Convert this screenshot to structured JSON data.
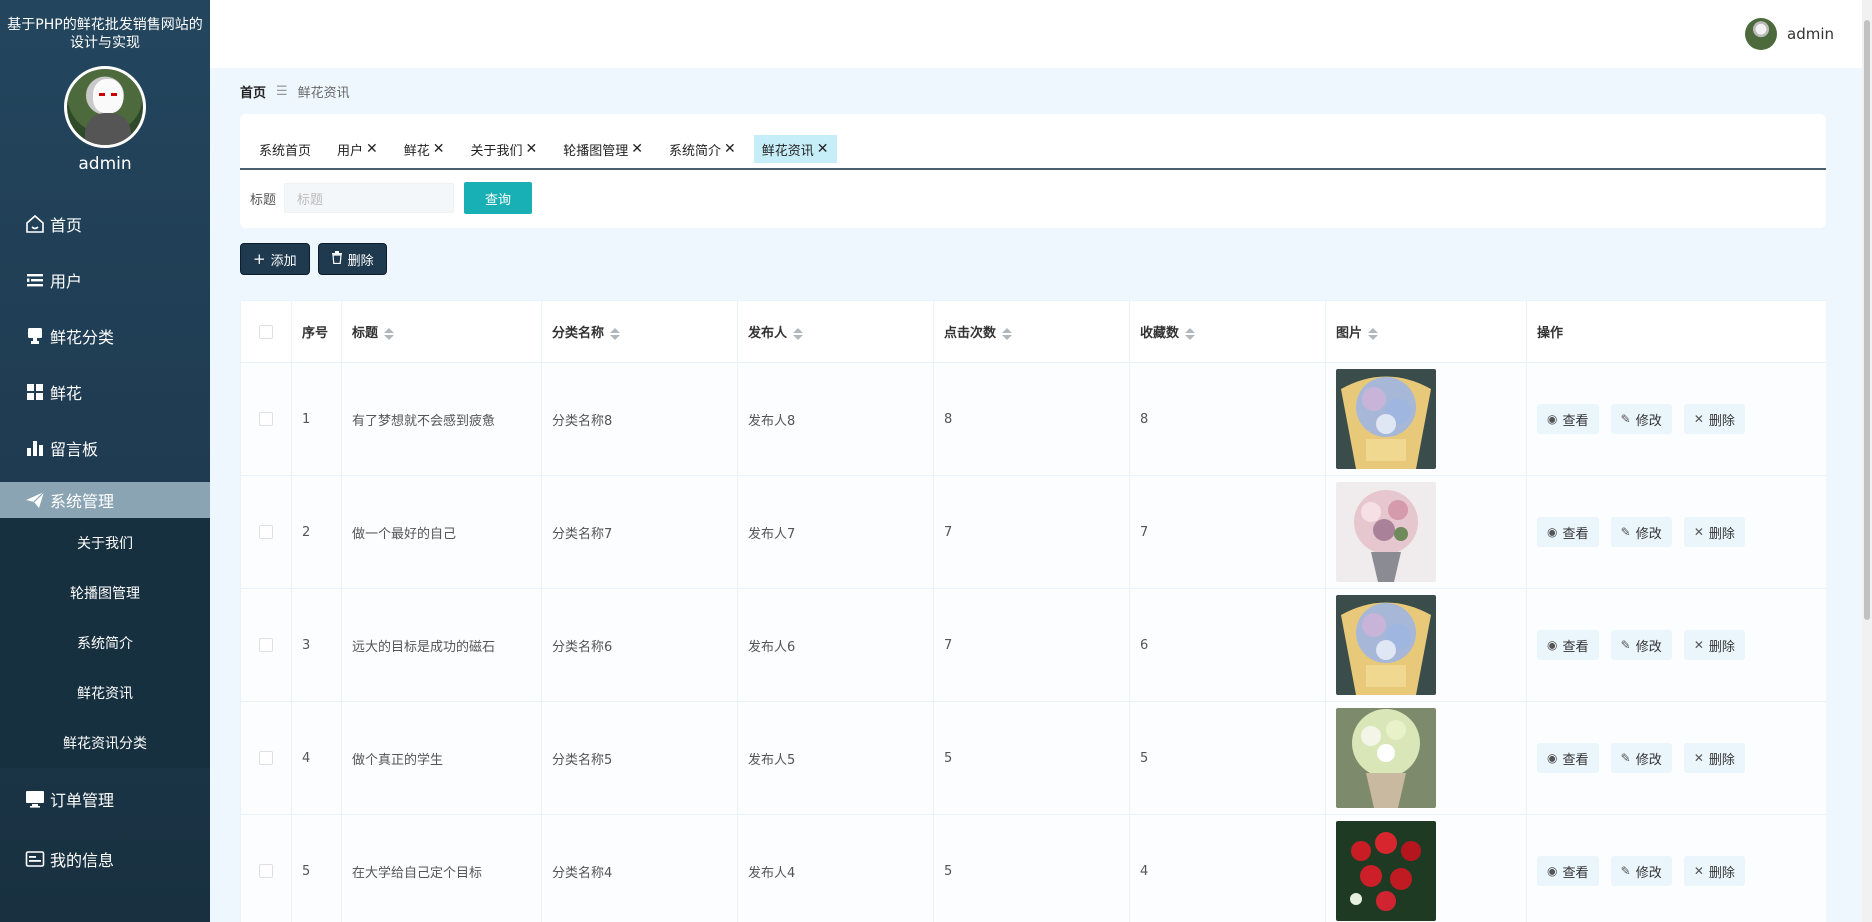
{
  "app_title": "基于PHP的鲜花批发销售网站的设计与实现",
  "user": {
    "name": "admin"
  },
  "sidebar": {
    "items": [
      {
        "label": "首页",
        "icon": "home-icon"
      },
      {
        "label": "用户",
        "icon": "list-icon"
      },
      {
        "label": "鲜花分类",
        "icon": "stamp-icon"
      },
      {
        "label": "鲜花",
        "icon": "grid-icon"
      },
      {
        "label": "留言板",
        "icon": "bar-chart-icon"
      },
      {
        "label": "系统管理",
        "icon": "paper-plane-icon"
      }
    ],
    "sub_items": [
      "关于我们",
      "轮播图管理",
      "系统简介",
      "鲜花资讯",
      "鲜花资讯分类"
    ],
    "after_items": [
      {
        "label": "订单管理",
        "icon": "monitor-icon"
      },
      {
        "label": "我的信息",
        "icon": "card-icon"
      }
    ]
  },
  "breadcrumb": {
    "home": "首页",
    "separator": "☰",
    "current": "鲜花资讯"
  },
  "tabs": [
    {
      "label": "系统首页",
      "closable": false
    },
    {
      "label": "用户",
      "closable": true
    },
    {
      "label": "鲜花",
      "closable": true
    },
    {
      "label": "关于我们",
      "closable": true
    },
    {
      "label": "轮播图管理",
      "closable": true
    },
    {
      "label": "系统简介",
      "closable": true
    },
    {
      "label": "鲜花资讯",
      "closable": true,
      "active": true
    }
  ],
  "tab_close_glyph": "✕",
  "search": {
    "label": "标题",
    "placeholder": "标题",
    "button": "查询"
  },
  "toolbar": {
    "add_label": "添加",
    "delete_label": "删除"
  },
  "table": {
    "headers": [
      "序号",
      "标题",
      "分类名称",
      "发布人",
      "点击次数",
      "收藏数",
      "图片",
      "操作"
    ],
    "rows": [
      {
        "index": "1",
        "title": "有了梦想就不会感到疲惫",
        "category": "分类名称8",
        "publisher": "发布人8",
        "clicks": "8",
        "favorites": "8",
        "image": "bouquet-blue-yellow"
      },
      {
        "index": "2",
        "title": "做一个最好的自己",
        "category": "分类名称7",
        "publisher": "发布人7",
        "clicks": "7",
        "favorites": "7",
        "image": "bouquet-pink"
      },
      {
        "index": "3",
        "title": "远大的目标是成功的磁石",
        "category": "分类名称6",
        "publisher": "发布人6",
        "clicks": "7",
        "favorites": "6",
        "image": "bouquet-blue-yellow"
      },
      {
        "index": "4",
        "title": "做个真正的学生",
        "category": "分类名称5",
        "publisher": "发布人5",
        "clicks": "5",
        "favorites": "5",
        "image": "bouquet-white-green"
      },
      {
        "index": "5",
        "title": "在大学给自己定个目标",
        "category": "分类名称4",
        "publisher": "发布人4",
        "clicks": "5",
        "favorites": "4",
        "image": "bouquet-red-roses"
      }
    ],
    "row_actions": {
      "view": "查看",
      "edit": "修改",
      "delete": "删除"
    }
  },
  "colors": {
    "sidebar": "#23465e",
    "accent": "#19b0b5",
    "active_tab": "#c6eef8",
    "button_dark": "#1f3a4e"
  }
}
